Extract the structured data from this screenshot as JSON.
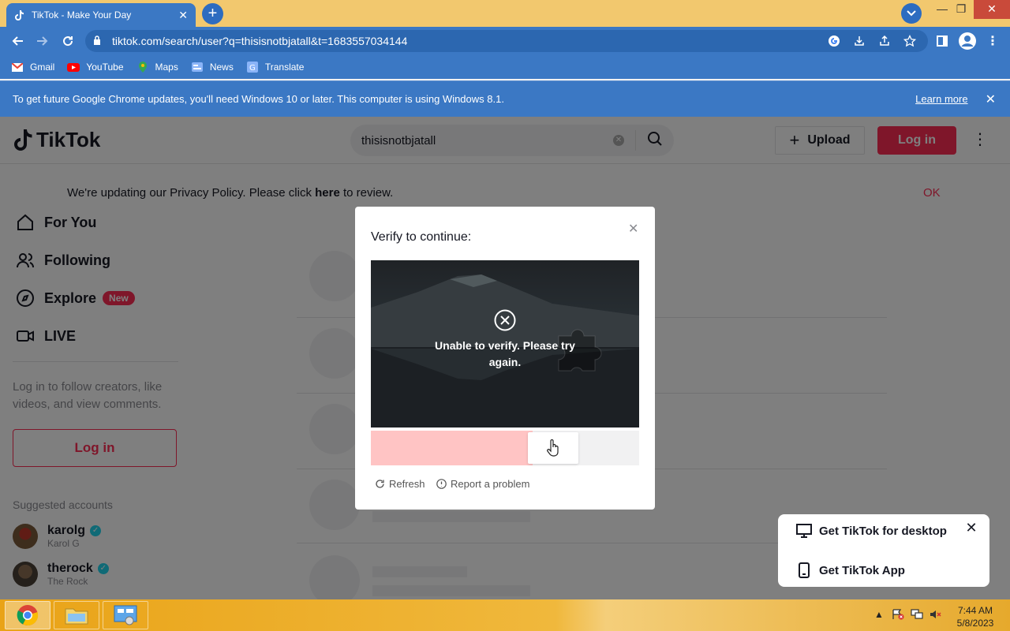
{
  "browser": {
    "tab_title": "TikTok - Make Your Day",
    "url": "tiktok.com/search/user?q=thisisnotbjatall&t=1683557034144",
    "bookmarks": [
      {
        "label": "Gmail",
        "icon": "gmail-icon"
      },
      {
        "label": "YouTube",
        "icon": "youtube-icon"
      },
      {
        "label": "Maps",
        "icon": "maps-icon"
      },
      {
        "label": "News",
        "icon": "news-icon"
      },
      {
        "label": "Translate",
        "icon": "translate-icon"
      }
    ],
    "infobar": {
      "message": "To get future Google Chrome updates, you'll need Windows 10 or later. This computer is using Windows 8.1.",
      "link": "Learn more"
    }
  },
  "tiktok": {
    "logo": "TikTok",
    "search_value": "thisisnotbjatall",
    "upload_label": "Upload",
    "login_label": "Log in",
    "privacy": {
      "text_before": "We're updating our Privacy Policy. Please click ",
      "here": "here",
      "text_after": " to review.",
      "ok": "OK"
    },
    "nav": [
      {
        "label": "For You",
        "icon": "home-icon"
      },
      {
        "label": "Following",
        "icon": "following-icon"
      },
      {
        "label": "Explore",
        "icon": "compass-icon",
        "badge": "New"
      },
      {
        "label": "LIVE",
        "icon": "live-icon"
      }
    ],
    "login_prompt": "Log in to follow creators, like videos, and view comments.",
    "sidebar_login": "Log in",
    "suggested_title": "Suggested accounts",
    "accounts": [
      {
        "name": "karolg",
        "sub": "Karol G"
      },
      {
        "name": "therock",
        "sub": "The Rock"
      }
    ],
    "get_app": {
      "desktop": "Get TikTok for desktop",
      "app": "Get TikTok App"
    }
  },
  "captcha": {
    "title": "Verify to continue:",
    "error": "Unable to verify. Please try again.",
    "slider_progress": 0.72,
    "refresh": "Refresh",
    "report": "Report a problem"
  },
  "taskbar": {
    "time": "7:44 AM",
    "date": "5/8/2023"
  },
  "colors": {
    "tiktok_red": "#fe2c55",
    "chrome_blue": "#3b78c4",
    "slider_fill": "#ffc4c4"
  }
}
